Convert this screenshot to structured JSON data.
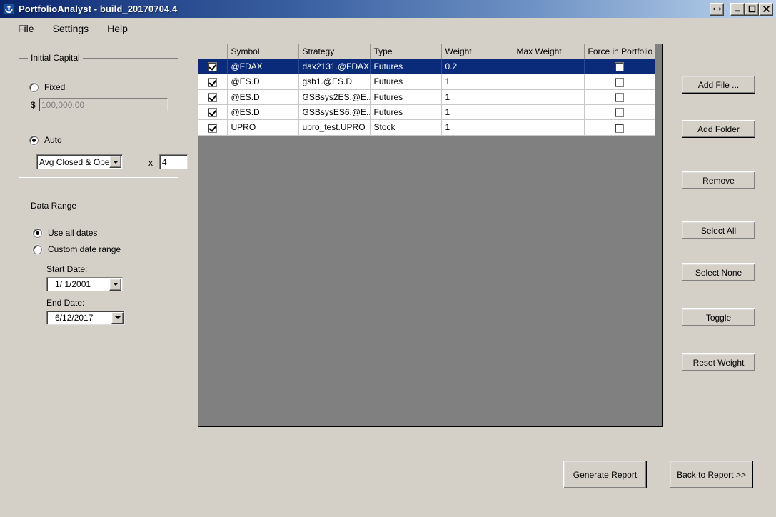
{
  "window": {
    "title": "PortfolioAnalyst - build_20170704.4",
    "app_icon": "portfolio-analyst-icon",
    "controls": {
      "restore_size_label": "↔",
      "minimize_label": "_",
      "maximize_label": "□",
      "close_label": "✕"
    }
  },
  "menu": {
    "items": [
      {
        "label": "File"
      },
      {
        "label": "Settings"
      },
      {
        "label": "Help"
      }
    ]
  },
  "initial_capital": {
    "group_title": "Initial Capital",
    "fixed_label": "Fixed",
    "fixed_selected": false,
    "currency_symbol": "$",
    "fixed_amount": "100,000.00",
    "auto_label": "Auto",
    "auto_selected": true,
    "method_value": "Avg Closed & Open",
    "multiply_symbol": "x",
    "multiplier": "4"
  },
  "data_range": {
    "group_title": "Data Range",
    "use_all_dates_label": "Use all dates",
    "use_all_dates_selected": true,
    "custom_range_label": "Custom date range",
    "custom_range_selected": false,
    "start_date_label": "Start Date:",
    "start_date_value": "1/ 1/2001",
    "end_date_label": "End Date:",
    "end_date_value": "6/12/2017"
  },
  "table": {
    "columns": [
      "",
      "Symbol",
      "Strategy",
      "Type",
      "Weight",
      "Max Weight",
      "Force in Portfolio"
    ],
    "rows": [
      {
        "selected": true,
        "enabled": true,
        "symbol": "@FDAX",
        "strategy": "dax2131.@FDAX",
        "type": "Futures",
        "weight": "0.2",
        "max_weight": "",
        "force_in_portfolio": false
      },
      {
        "selected": false,
        "enabled": true,
        "symbol": "@ES.D",
        "strategy": "gsb1.@ES.D",
        "type": "Futures",
        "weight": "1",
        "max_weight": "",
        "force_in_portfolio": false
      },
      {
        "selected": false,
        "enabled": true,
        "symbol": "@ES.D",
        "strategy": "GSBsys2ES.@E...",
        "type": "Futures",
        "weight": "1",
        "max_weight": "",
        "force_in_portfolio": false
      },
      {
        "selected": false,
        "enabled": true,
        "symbol": "@ES.D",
        "strategy": "GSBsysES6.@E...",
        "type": "Futures",
        "weight": "1",
        "max_weight": "",
        "force_in_portfolio": false
      },
      {
        "selected": false,
        "enabled": true,
        "symbol": "UPRO",
        "strategy": "upro_test.UPRO",
        "type": "Stock",
        "weight": "1",
        "max_weight": "",
        "force_in_portfolio": false
      }
    ]
  },
  "side_buttons": [
    {
      "label": "Add File ..."
    },
    {
      "label": "Add Folder"
    },
    {
      "label": "Remove"
    },
    {
      "label": "Select All"
    },
    {
      "label": "Select None"
    },
    {
      "label": "Toggle"
    },
    {
      "label": "Reset Weight"
    }
  ],
  "bottom_buttons": {
    "generate_report": "Generate Report",
    "back_to_report": "Back to Report >>"
  },
  "colors": {
    "window_background": "#d4d0c8",
    "titlebar_start": "#0a246a",
    "titlebar_end": "#c3d5ec",
    "selection": "#0a2a7a",
    "table_empty": "#808080"
  }
}
